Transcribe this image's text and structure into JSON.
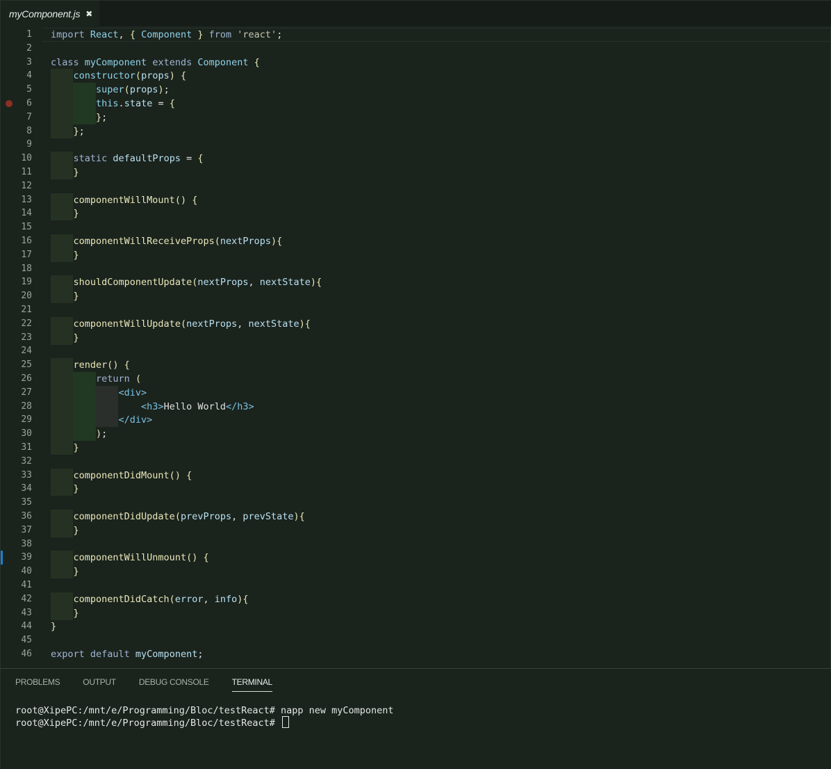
{
  "tab": {
    "filename": "myComponent.js",
    "close_glyph": "✖"
  },
  "editor": {
    "lines": [
      {
        "n": "1",
        "tokens": [
          [
            "kw",
            "import "
          ],
          [
            "cls",
            "React"
          ],
          [
            "txt",
            ", "
          ],
          [
            "fn",
            "{ "
          ],
          [
            "cls",
            "Component"
          ],
          [
            "fn",
            " }"
          ],
          [
            "kw",
            " from "
          ],
          [
            "str",
            "'react'"
          ],
          [
            "txt",
            ";"
          ]
        ]
      },
      {
        "n": "2",
        "tokens": []
      },
      {
        "n": "3",
        "tokens": [
          [
            "kw",
            "class "
          ],
          [
            "cls",
            "myComponent"
          ],
          [
            "kw",
            " extends "
          ],
          [
            "cls",
            "Component"
          ],
          [
            "fn",
            " {"
          ]
        ]
      },
      {
        "n": "4",
        "tokens": [
          [
            "txt",
            "    "
          ],
          [
            "cls",
            "constructor"
          ],
          [
            "fn",
            "("
          ],
          [
            "var",
            "props"
          ],
          [
            "fn",
            ") {"
          ]
        ]
      },
      {
        "n": "5",
        "tokens": [
          [
            "txt",
            "        "
          ],
          [
            "cls",
            "super"
          ],
          [
            "fn",
            "("
          ],
          [
            "var",
            "props"
          ],
          [
            "fn",
            ")"
          ],
          [
            "txt",
            ";"
          ]
        ]
      },
      {
        "n": "6",
        "tokens": [
          [
            "txt",
            "        "
          ],
          [
            "cls",
            "this"
          ],
          [
            "txt",
            "."
          ],
          [
            "var",
            "state"
          ],
          [
            "txt",
            " = "
          ],
          [
            "fn",
            "{"
          ]
        ]
      },
      {
        "n": "7",
        "tokens": [
          [
            "txt",
            "        "
          ],
          [
            "fn",
            "}"
          ],
          [
            "txt",
            ";"
          ]
        ]
      },
      {
        "n": "8",
        "tokens": [
          [
            "txt",
            "    "
          ],
          [
            "fn",
            "}"
          ],
          [
            "txt",
            ";"
          ]
        ]
      },
      {
        "n": "9",
        "tokens": []
      },
      {
        "n": "10",
        "tokens": [
          [
            "txt",
            "    "
          ],
          [
            "kw",
            "static "
          ],
          [
            "var",
            "defaultProps"
          ],
          [
            "txt",
            " = "
          ],
          [
            "fn",
            "{"
          ]
        ]
      },
      {
        "n": "11",
        "tokens": [
          [
            "txt",
            "    "
          ],
          [
            "fn",
            "}"
          ]
        ]
      },
      {
        "n": "12",
        "tokens": []
      },
      {
        "n": "13",
        "tokens": [
          [
            "txt",
            "    "
          ],
          [
            "fn",
            "componentWillMount() {"
          ]
        ]
      },
      {
        "n": "14",
        "tokens": [
          [
            "txt",
            "    "
          ],
          [
            "fn",
            "}"
          ]
        ]
      },
      {
        "n": "15",
        "tokens": []
      },
      {
        "n": "16",
        "tokens": [
          [
            "txt",
            "    "
          ],
          [
            "fn",
            "componentWillReceiveProps("
          ],
          [
            "var",
            "nextProps"
          ],
          [
            "fn",
            "){"
          ]
        ]
      },
      {
        "n": "17",
        "tokens": [
          [
            "txt",
            "    "
          ],
          [
            "fn",
            "}"
          ]
        ]
      },
      {
        "n": "18",
        "tokens": []
      },
      {
        "n": "19",
        "tokens": [
          [
            "txt",
            "    "
          ],
          [
            "fn",
            "shouldComponentUpdate("
          ],
          [
            "var",
            "nextProps"
          ],
          [
            "txt",
            ", "
          ],
          [
            "var",
            "nextState"
          ],
          [
            "fn",
            "){"
          ]
        ]
      },
      {
        "n": "20",
        "tokens": [
          [
            "txt",
            "    "
          ],
          [
            "fn",
            "}"
          ]
        ]
      },
      {
        "n": "21",
        "tokens": []
      },
      {
        "n": "22",
        "tokens": [
          [
            "txt",
            "    "
          ],
          [
            "fn",
            "componentWillUpdate("
          ],
          [
            "var",
            "nextProps"
          ],
          [
            "txt",
            ", "
          ],
          [
            "var",
            "nextState"
          ],
          [
            "fn",
            "){"
          ]
        ]
      },
      {
        "n": "23",
        "tokens": [
          [
            "txt",
            "    "
          ],
          [
            "fn",
            "}"
          ]
        ]
      },
      {
        "n": "24",
        "tokens": []
      },
      {
        "n": "25",
        "tokens": [
          [
            "txt",
            "    "
          ],
          [
            "fn",
            "render() {"
          ]
        ]
      },
      {
        "n": "26",
        "tokens": [
          [
            "txt",
            "        "
          ],
          [
            "kw",
            "return "
          ],
          [
            "fn",
            "("
          ]
        ]
      },
      {
        "n": "27",
        "tokens": [
          [
            "txt",
            "            "
          ],
          [
            "tag",
            "<div>"
          ]
        ]
      },
      {
        "n": "28",
        "tokens": [
          [
            "txt",
            "                "
          ],
          [
            "tag",
            "<h3>"
          ],
          [
            "txt",
            "Hello World"
          ],
          [
            "tag",
            "</h3>"
          ]
        ]
      },
      {
        "n": "29",
        "tokens": [
          [
            "txt",
            "            "
          ],
          [
            "tag",
            "</div>"
          ]
        ]
      },
      {
        "n": "30",
        "tokens": [
          [
            "txt",
            "        "
          ],
          [
            "fn",
            ")"
          ],
          [
            "txt",
            ";"
          ]
        ]
      },
      {
        "n": "31",
        "tokens": [
          [
            "txt",
            "    "
          ],
          [
            "fn",
            "}"
          ]
        ]
      },
      {
        "n": "32",
        "tokens": []
      },
      {
        "n": "33",
        "tokens": [
          [
            "txt",
            "    "
          ],
          [
            "fn",
            "componentDidMount() {"
          ]
        ]
      },
      {
        "n": "34",
        "tokens": [
          [
            "txt",
            "    "
          ],
          [
            "fn",
            "}"
          ]
        ]
      },
      {
        "n": "35",
        "tokens": []
      },
      {
        "n": "36",
        "tokens": [
          [
            "txt",
            "    "
          ],
          [
            "fn",
            "componentDidUpdate("
          ],
          [
            "var",
            "prevProps"
          ],
          [
            "txt",
            ", "
          ],
          [
            "var",
            "prevState"
          ],
          [
            "fn",
            "){"
          ]
        ]
      },
      {
        "n": "37",
        "tokens": [
          [
            "txt",
            "    "
          ],
          [
            "fn",
            "}"
          ]
        ]
      },
      {
        "n": "38",
        "tokens": []
      },
      {
        "n": "39",
        "tokens": [
          [
            "txt",
            "    "
          ],
          [
            "fn",
            "componentWillUnmount() {"
          ]
        ]
      },
      {
        "n": "40",
        "tokens": [
          [
            "txt",
            "    "
          ],
          [
            "fn",
            "}"
          ]
        ]
      },
      {
        "n": "41",
        "tokens": []
      },
      {
        "n": "42",
        "tokens": [
          [
            "txt",
            "    "
          ],
          [
            "fn",
            "componentDidCatch("
          ],
          [
            "var",
            "error"
          ],
          [
            "txt",
            ", "
          ],
          [
            "var",
            "info"
          ],
          [
            "fn",
            "){"
          ]
        ]
      },
      {
        "n": "43",
        "tokens": [
          [
            "txt",
            "    "
          ],
          [
            "fn",
            "}"
          ]
        ]
      },
      {
        "n": "44",
        "tokens": [
          [
            "fn",
            "}"
          ]
        ]
      },
      {
        "n": "45",
        "tokens": []
      },
      {
        "n": "46",
        "tokens": [
          [
            "kw",
            "export default "
          ],
          [
            "var",
            "myComponent"
          ],
          [
            "txt",
            ";"
          ]
        ]
      }
    ]
  },
  "panel": {
    "tabs": [
      {
        "label": "PROBLEMS",
        "active": false
      },
      {
        "label": "OUTPUT",
        "active": false
      },
      {
        "label": "DEBUG CONSOLE",
        "active": false
      },
      {
        "label": "TERMINAL",
        "active": true
      }
    ]
  },
  "terminal": {
    "lines": [
      "root@XipePC:/mnt/e/Programming/Bloc/testReact# napp new myComponent",
      "root@XipePC:/mnt/e/Programming/Bloc/testReact# "
    ]
  },
  "colors": {
    "background": "#1b231d",
    "breakpoint": "#8e2f26",
    "modified_gutter": "#1f7fd1"
  }
}
